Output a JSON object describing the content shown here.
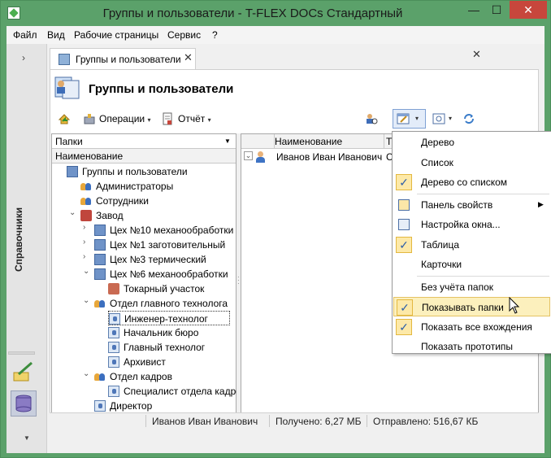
{
  "window": {
    "title": "Группы и пользователи - T-FLEX DOCs Стандартный",
    "min_label": "—",
    "max_label": "☐",
    "close_label": "✕"
  },
  "menubar": [
    "Файл",
    "Вид",
    "Рабочие страницы",
    "Сервис",
    "?"
  ],
  "leftstrip": {
    "collapse_glyph": "›",
    "vertical_label": "Справочники",
    "scroll_down_glyph": "▼"
  },
  "tab": {
    "label": "Группы и пользователи",
    "close": "✕",
    "panel_close": "✕"
  },
  "header": {
    "title": "Группы и пользователи"
  },
  "toolbar": {
    "operations_label": "Операции",
    "report_label": "Отчёт",
    "caret": "▾"
  },
  "leftpane": {
    "combo_value": "Папки",
    "combo_arrow": "▼",
    "column_header": "Наименование",
    "tree": [
      {
        "label": "Группы и пользователи",
        "icon": "users-root-icon",
        "indent": 0,
        "expander": ""
      },
      {
        "label": "Администраторы",
        "icon": "users-group-icon",
        "indent": 1,
        "expander": ""
      },
      {
        "label": "Сотрудники",
        "icon": "users-group-icon",
        "indent": 1,
        "expander": ""
      },
      {
        "label": "Завод",
        "icon": "factory-icon",
        "indent": 1,
        "expander": "⌄"
      },
      {
        "label": "Цех №10 механообработки",
        "icon": "workshop-icon",
        "indent": 2,
        "expander": "›"
      },
      {
        "label": "Цех №1 заготовительный",
        "icon": "workshop-icon",
        "indent": 2,
        "expander": "›"
      },
      {
        "label": "Цех №3 термический",
        "icon": "workshop-icon",
        "indent": 2,
        "expander": "›"
      },
      {
        "label": "Цех №6 механообработки",
        "icon": "workshop-icon",
        "indent": 2,
        "expander": "⌄"
      },
      {
        "label": "Токарный участок",
        "icon": "section-icon",
        "indent": 3,
        "expander": ""
      },
      {
        "label": "Отдел главного технолога",
        "icon": "users-group-icon",
        "indent": 2,
        "expander": "⌄"
      },
      {
        "label": "Инженер-технолог",
        "icon": "role-icon",
        "indent": 3,
        "expander": "",
        "selected": true
      },
      {
        "label": "Начальник бюро",
        "icon": "role-icon",
        "indent": 3,
        "expander": ""
      },
      {
        "label": "Главный технолог",
        "icon": "role-icon",
        "indent": 3,
        "expander": ""
      },
      {
        "label": "Архивист",
        "icon": "role-icon",
        "indent": 3,
        "expander": ""
      },
      {
        "label": "Отдел кадров",
        "icon": "users-group-icon",
        "indent": 2,
        "expander": "⌄"
      },
      {
        "label": "Специалист отдела кадров",
        "icon": "role-icon",
        "indent": 3,
        "expander": ""
      },
      {
        "label": "Директор",
        "icon": "role-icon",
        "indent": 2,
        "expander": ""
      }
    ]
  },
  "rightpane": {
    "column_name": "Наименование",
    "column_type": "Т",
    "row_name": "Иванов Иван Иванович",
    "row_type": "С",
    "row_expander": "⌄"
  },
  "status": {
    "user": "Иванов Иван Иванович",
    "received": "Получено: 6,27 МБ",
    "sent": "Отправлено: 516,67 КБ"
  },
  "dropdown": [
    {
      "label": "Дерево",
      "checked": false,
      "icon": ""
    },
    {
      "label": "Список",
      "checked": false,
      "icon": ""
    },
    {
      "label": "Дерево со списком",
      "checked": true,
      "icon": ""
    },
    {
      "separator": true
    },
    {
      "label": "Панель свойств",
      "checked": false,
      "icon": "properties-panel-icon",
      "submenu": "▶"
    },
    {
      "label": "Настройка окна...",
      "checked": false,
      "icon": "window-settings-icon"
    },
    {
      "label": "Таблица",
      "checked": true,
      "icon": ""
    },
    {
      "label": "Карточки",
      "checked": false,
      "icon": ""
    },
    {
      "separator": true
    },
    {
      "label": "Без учёта папок",
      "checked": false,
      "icon": ""
    },
    {
      "label": "Показывать папки",
      "checked": true,
      "icon": "",
      "hover": true
    },
    {
      "label": "Показать все вхождения",
      "checked": true,
      "icon": ""
    },
    {
      "label": "Показать прототипы",
      "checked": false,
      "icon": ""
    }
  ],
  "check_glyph": "✓"
}
